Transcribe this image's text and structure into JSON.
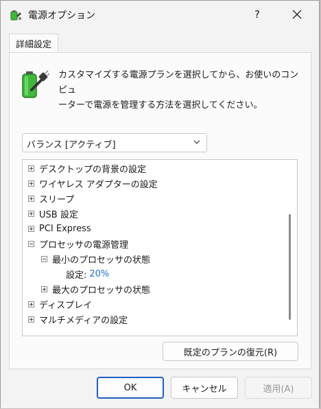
{
  "window": {
    "title": "電源オプション",
    "help_label": "?",
    "close_label": "✕"
  },
  "tab": {
    "label": "詳細設定"
  },
  "description": "カスタマイズする電源プランを選択してから、お使いのコンピュ\nーターで電源を管理する方法を選択してください。",
  "plan_select": {
    "value": "バランス [アクティブ]"
  },
  "tree": {
    "items": [
      {
        "label": "デスクトップの背景の設定",
        "state": "collapsed"
      },
      {
        "label": "ワイヤレス アダプターの設定",
        "state": "collapsed"
      },
      {
        "label": "スリープ",
        "state": "collapsed"
      },
      {
        "label": "USB 設定",
        "state": "collapsed"
      },
      {
        "label": "PCI Express",
        "state": "collapsed"
      },
      {
        "label": "プロセッサの電源管理",
        "state": "expanded"
      },
      {
        "label": "最小のプロセッサの状態",
        "state": "expanded"
      },
      {
        "label": "設定:",
        "value": "20%"
      },
      {
        "label": "最大のプロセッサの状態",
        "state": "collapsed"
      },
      {
        "label": "ディスプレイ",
        "state": "collapsed"
      },
      {
        "label": "マルチメディアの設定",
        "state": "collapsed"
      }
    ]
  },
  "restore_button": {
    "label": "既定のプランの復元(R)"
  },
  "footer": {
    "ok_label": "OK",
    "cancel_label": "キャンセル",
    "apply_label": "適用(A)"
  },
  "colors": {
    "accent": "#1f5fbf",
    "value_text": "#1f6fcf",
    "battery_green": "#3fb83a"
  },
  "icons": [
    "power-options-icon",
    "battery-plug-icon",
    "chevron-down-icon",
    "expand-plus-icon",
    "collapse-minus-icon"
  ]
}
